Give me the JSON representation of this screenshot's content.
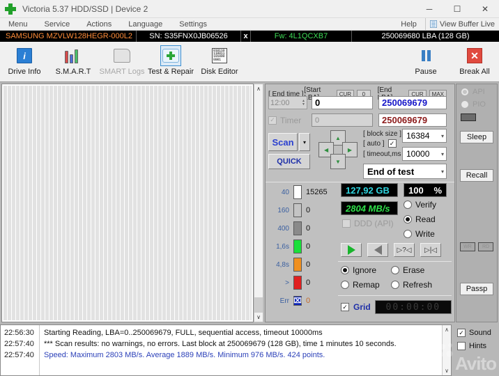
{
  "window": {
    "title": "Victoria 5.37 HDD/SSD | Device 2",
    "logo_icon": "green-cross-icon",
    "minimize": "─",
    "maximize": "☐",
    "close": "✕"
  },
  "menubar": {
    "items": [
      "Menu",
      "Service",
      "Actions",
      "Language",
      "Settings"
    ],
    "help": "Help",
    "view_buffer_live": "View Buffer Live"
  },
  "drive_bar": {
    "model": "SAMSUNG MZVLW128HEGR-000L2",
    "serial": "SN: S35FNX0JB06526",
    "close_btn": "x",
    "firmware": "Fw: 4L1QCXB7",
    "capacity": "250069680 LBA (128 GB)"
  },
  "toolbar": {
    "buttons": [
      {
        "label": "Drive Info",
        "icon": "info-icon",
        "state": "normal"
      },
      {
        "label": "S.M.A.R.T",
        "icon": "test-tubes-icon",
        "state": "normal"
      },
      {
        "label": "SMART Logs",
        "icon": "folder-icon",
        "state": "disabled"
      },
      {
        "label": "Test & Repair",
        "icon": "first-aid-icon",
        "state": "active"
      },
      {
        "label": "Disk Editor",
        "icon": "binary-page-icon",
        "state": "normal"
      }
    ],
    "editor_binary": "010110\n110011\n101000\n0001",
    "pause": {
      "label": "Pause",
      "icon": "pause-icon"
    },
    "break_all": {
      "label": "Break All",
      "icon": "red-x-icon"
    }
  },
  "test_panel": {
    "end_time_label": "[ End time ]",
    "end_time_value": "12:00",
    "timer_label": "Timer",
    "start_lba_label": "[Start LBA]",
    "start_lba_cur": "CUR",
    "start_lba_min": "0",
    "start_lba_value": "0",
    "start_lba_second": "0",
    "end_lba_label": "[End LBA]",
    "end_lba_cur": "CUR",
    "end_lba_max": "MAX",
    "end_lba_value": "250069679",
    "end_lba_second": "250069679",
    "scan_button": "Scan",
    "quick_button": "QUICK",
    "dropdown_arrow": "▾",
    "nav": {
      "up": "▲",
      "down": "▼",
      "left": "◀",
      "right": "▶"
    },
    "block_size_label": "[ block size ]",
    "block_size_value": "16384",
    "auto_label": "[ auto ]",
    "auto_checked": true,
    "timeout_label": "[ timeout,ms ]",
    "timeout_value": "10000",
    "end_of_test_value": "End of test"
  },
  "legend": {
    "rows": [
      {
        "key": "40",
        "color": "#ffffff",
        "value": "15265"
      },
      {
        "key": "160",
        "color": "#c4c4c4",
        "value": "0"
      },
      {
        "key": "400",
        "color": "#8a8a8a",
        "value": "0"
      },
      {
        "key": "1,6s",
        "color": "#1ae03a",
        "value": "0"
      },
      {
        "key": "4,8s",
        "color": "#f09020",
        "value": "0"
      },
      {
        "key": ">",
        "color": "#e02020",
        "value": "0"
      },
      {
        "key": "Err",
        "color": "#0b23b8",
        "value": "0"
      }
    ],
    "err_glyph": "⌧"
  },
  "stats": {
    "capacity": "127,92 GB",
    "speed": "2804 MB/s",
    "percent_value": "100",
    "percent_unit": "%",
    "ddd_api_label": "DDD (API)",
    "ddd_api_checked": false,
    "modes": [
      {
        "label": "Verify",
        "selected": false
      },
      {
        "label": "Read",
        "selected": true
      },
      {
        "label": "Write",
        "selected": false
      }
    ],
    "transport_buttons": [
      "play-icon",
      "reverse-icon",
      "step-question-icon",
      "step-end-icon"
    ],
    "actions": [
      {
        "label": "Ignore",
        "selected": true
      },
      {
        "label": "Erase",
        "selected": false
      },
      {
        "label": "Remap",
        "selected": false
      },
      {
        "label": "Refresh",
        "selected": false
      }
    ],
    "grid_label": "Grid",
    "grid_checked": true,
    "timer_display": "00:00:00"
  },
  "right_rail": {
    "api_label": "API",
    "api_selected": true,
    "pio_label": "PIO",
    "pio_selected": false,
    "sleep": "Sleep",
    "recall": "Recall",
    "wr": "WR",
    "rd": "RD",
    "passport": "Passp"
  },
  "log": {
    "entries": [
      {
        "time": "22:56:30",
        "message": "Starting Reading, LBA=0..250069679, FULL, sequential access, timeout 10000ms",
        "color": "dark"
      },
      {
        "time": "22:57:40",
        "message": "*** Scan results: no warnings, no errors. Last block at 250069679 (128 GB), time 1 minutes 10 seconds.",
        "color": "dark"
      },
      {
        "time": "22:57:40",
        "message": "Speed: Maximum 2803 MB/s. Average 1889 MB/s. Minimum 976 MB/s. 424 points.",
        "color": "blue"
      }
    ],
    "scroll_up": "∧",
    "scroll_down": "∨"
  },
  "footer_options": {
    "sound": {
      "label": "Sound",
      "checked": true
    },
    "hints": {
      "label": "Hints",
      "checked": false
    }
  },
  "watermark": "Avito",
  "colors": {
    "accent_green": "#21a02a",
    "model_orange": "#ff8c38",
    "firmware_green": "#3ddc56",
    "lcd_cyan": "#2fd6e0",
    "lcd_green": "#2fe04a",
    "scan_blue": "#2a3fd0",
    "end_lba_blue": "#1515c8",
    "end_lba_maroon": "#8c1a1a",
    "log_blue": "#2a3fb8"
  }
}
